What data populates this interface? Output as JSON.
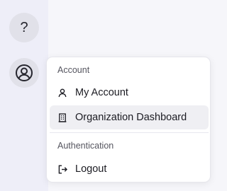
{
  "sidebar": {
    "help_label": "?"
  },
  "menu": {
    "sections": [
      {
        "label": "Account",
        "items": [
          {
            "label": "My Account",
            "icon": "user-icon"
          },
          {
            "label": "Organization Dashboard",
            "icon": "building-icon"
          }
        ]
      },
      {
        "label": "Authentication",
        "items": [
          {
            "label": "Logout",
            "icon": "logout-icon"
          }
        ]
      }
    ]
  },
  "colors": {
    "sidebar_bg": "#eeeef8",
    "button_bg": "#e1e1e9",
    "active_item_bg": "#efeff3"
  }
}
